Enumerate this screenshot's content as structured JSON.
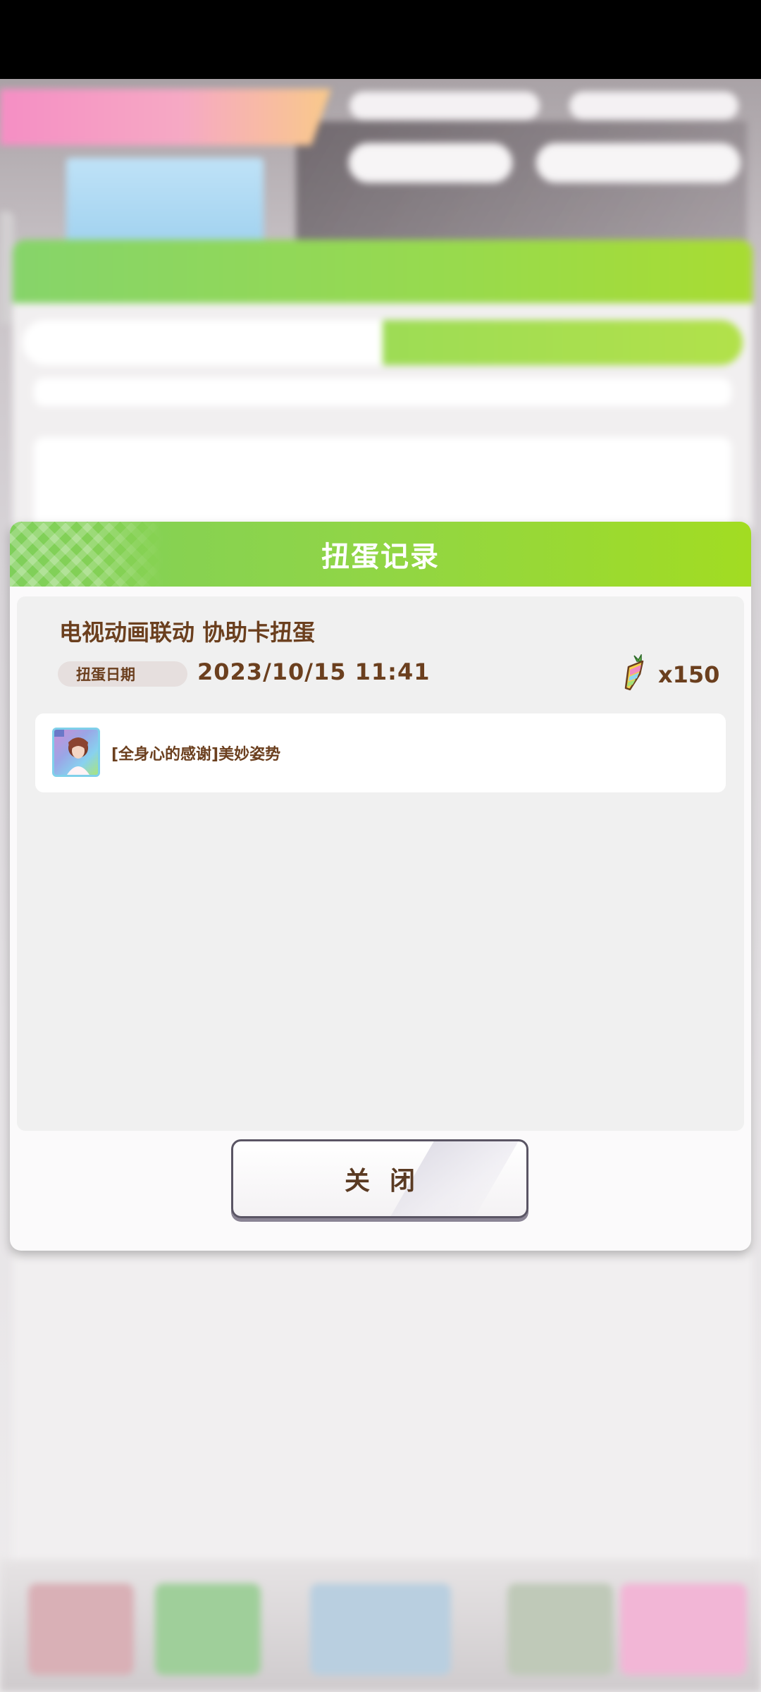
{
  "dialog": {
    "title": "扭蛋记录",
    "record_title": "电视动画联动  协助卡扭蛋",
    "date_label": "扭蛋日期",
    "date_value": "2023/10/15  11:41",
    "cost_icon": "carrot-icon",
    "cost_value": "x150",
    "results": [
      {
        "icon": "support-card-thumbnail",
        "text": "[全身心的感谢]美妙姿势"
      }
    ],
    "close_label": "关闭"
  },
  "colors": {
    "header_green_start": "#7fcf5a",
    "header_green_end": "#a2dc22",
    "text_brown": "#6b3f1e",
    "body_gray": "#f0f0f0"
  }
}
